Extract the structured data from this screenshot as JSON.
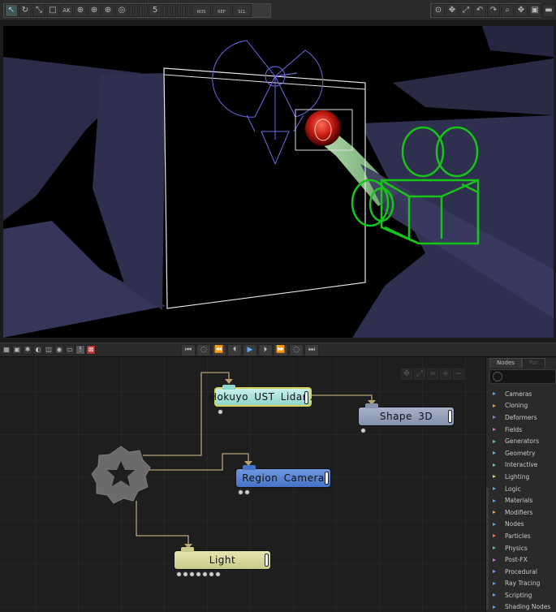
{
  "toolbar": {
    "left_tools": [
      "↖",
      "↻",
      "⤡",
      "□",
      "AK",
      "⊕",
      "⊕",
      "⊕",
      "◎",
      "5"
    ],
    "presets": [
      "ROS",
      "REP",
      "SCL"
    ],
    "right_tools": [
      "⊙",
      "✥",
      "⤢",
      "↶",
      "↷",
      "⌕",
      "✥",
      "▣",
      "▬"
    ]
  },
  "playback": {
    "view_buttons": [
      "▦",
      "▣",
      "✱",
      "◐",
      "◫",
      "◉",
      "▭",
      "!",
      "⊠"
    ],
    "transport": [
      "⏮",
      "◌",
      "⏪",
      "⏴",
      "▶",
      "⏵",
      "⏩",
      "◌",
      "⏭"
    ]
  },
  "node_editor": {
    "tools": [
      "✥",
      "⤢",
      "=",
      "+",
      "−"
    ],
    "nodes": {
      "hokuyo": "Hokuyo UST Lidar...",
      "shape": "Shape 3D",
      "region_camera": "Region Camera",
      "light": "Light"
    }
  },
  "side_panel": {
    "tabs": [
      "Nodes",
      "Par"
    ],
    "search_placeholder": "",
    "categories": [
      {
        "label": "Cameras",
        "color": "#5aa0ff"
      },
      {
        "label": "Cloning",
        "color": "#e0a040"
      },
      {
        "label": "Deformers",
        "color": "#a070ff"
      },
      {
        "label": "Fields",
        "color": "#e070c0"
      },
      {
        "label": "Generators",
        "color": "#60c080"
      },
      {
        "label": "Geometry",
        "color": "#60b0ff"
      },
      {
        "label": "Interactive",
        "color": "#60c0c0"
      },
      {
        "label": "Lighting",
        "color": "#e0d060"
      },
      {
        "label": "Logic",
        "color": "#6a9aff"
      },
      {
        "label": "Materials",
        "color": "#6a9aff"
      },
      {
        "label": "Modifiers",
        "color": "#f0a040"
      },
      {
        "label": "Nodes",
        "color": "#6a9aff"
      },
      {
        "label": "Particles",
        "color": "#ff7060"
      },
      {
        "label": "Physics",
        "color": "#60c080"
      },
      {
        "label": "Post-FX",
        "color": "#c070ff"
      },
      {
        "label": "Procedural",
        "color": "#6a9aff"
      },
      {
        "label": "Ray Tracing",
        "color": "#6a9aff"
      },
      {
        "label": "Scripting",
        "color": "#6a9aff"
      },
      {
        "label": "Shading Nodes",
        "color": "#6a9aff"
      }
    ]
  }
}
